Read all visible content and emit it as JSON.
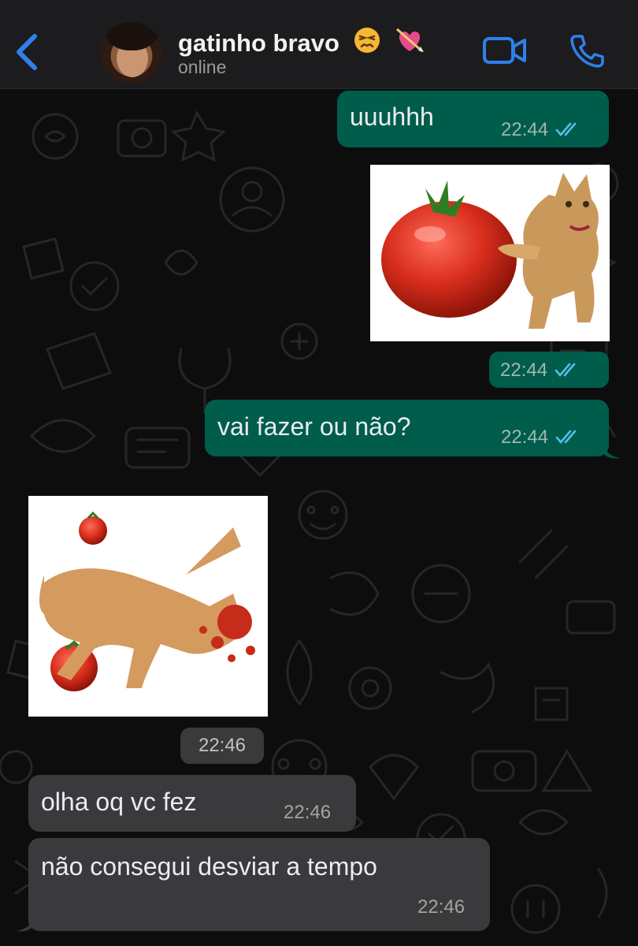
{
  "header": {
    "contact_name": "gatinho bravo",
    "status": "online",
    "emojis": [
      "persevering-face-emoji",
      "heart-with-arrow-emoji"
    ]
  },
  "messages": [
    {
      "id": "m1",
      "direction": "outgoing",
      "type": "text",
      "text": "uuuhhh",
      "time": "22:44",
      "read": true
    },
    {
      "id": "m2",
      "direction": "outgoing",
      "type": "image",
      "image": "tomato-and-angry-cat-sticker",
      "time": "22:44",
      "read": true
    },
    {
      "id": "m3",
      "direction": "outgoing",
      "type": "text",
      "text": "vai fazer ou não?",
      "time": "22:44",
      "read": true
    },
    {
      "id": "m4",
      "direction": "incoming",
      "type": "image",
      "image": "cat-hit-by-tomato-sticker"
    },
    {
      "id": "m5",
      "direction": "incoming",
      "type": "time-pill",
      "time": "22:46"
    },
    {
      "id": "m6",
      "direction": "incoming",
      "type": "text",
      "text": "olha oq vc fez",
      "time": "22:46"
    },
    {
      "id": "m7",
      "direction": "incoming",
      "type": "text",
      "text": "não consegui desviar a tempo",
      "time": "22:46"
    }
  ],
  "colors": {
    "outgoing_bubble": "#005c4b",
    "incoming_bubble": "#3a3a3c",
    "accent_blue": "#2f80ed",
    "read_ticks": "#53bdeb",
    "header_bg": "#1c1c1e",
    "chat_bg": "#0d0d0d"
  }
}
